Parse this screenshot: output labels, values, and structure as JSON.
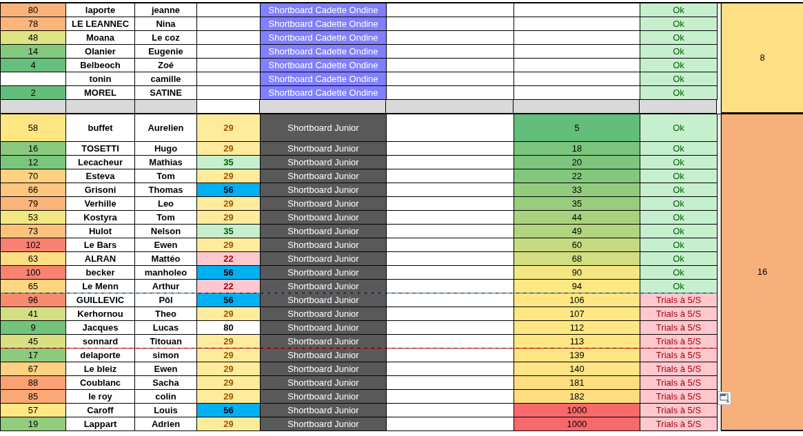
{
  "sections": [
    {
      "group": {
        "text": "8",
        "color": "#ffdf84"
      },
      "spacer_after": true,
      "rows": [
        {
          "rank": {
            "text": "80",
            "color": "#fbb27a"
          },
          "last": "laporte",
          "first": "jeanne",
          "category": {
            "text": "Shortboard Cadette Ondine",
            "kind": "cadette"
          },
          "status": {
            "text": "Ok",
            "kind": "ok"
          }
        },
        {
          "rank": {
            "text": "78",
            "color": "#fbb57b"
          },
          "last": "LE LEANNEC",
          "first": "Nina",
          "category": {
            "text": "Shortboard Cadette Ondine",
            "kind": "cadette"
          },
          "status": {
            "text": "Ok",
            "kind": "ok"
          }
        },
        {
          "rank": {
            "text": "48",
            "color": "#e1e383"
          },
          "last": "Moana",
          "first": "Le coz",
          "category": {
            "text": "Shortboard Cadette Ondine",
            "kind": "cadette"
          },
          "status": {
            "text": "Ok",
            "kind": "ok"
          }
        },
        {
          "rank": {
            "text": "14",
            "color": "#85c97d"
          },
          "last": "Olanier",
          "first": "Eugenie",
          "category": {
            "text": "Shortboard Cadette Ondine",
            "kind": "cadette"
          },
          "status": {
            "text": "Ok",
            "kind": "ok"
          }
        },
        {
          "rank": {
            "text": "4",
            "color": "#66bf7c"
          },
          "last": "Belbeoch",
          "first": "Zoé",
          "category": {
            "text": "Shortboard Cadette Ondine",
            "kind": "cadette"
          },
          "status": {
            "text": "Ok",
            "kind": "ok"
          }
        },
        {
          "last": "tonin",
          "first": "camille",
          "category": {
            "text": "Shortboard Cadette Ondine",
            "kind": "cadette"
          },
          "status": {
            "text": "Ok",
            "kind": "ok"
          }
        },
        {
          "rank": {
            "text": "2",
            "color": "#63be7b"
          },
          "last": "MOREL",
          "first": "SATINE",
          "category": {
            "text": "Shortboard Cadette Ondine",
            "kind": "cadette"
          },
          "status": {
            "text": "Ok",
            "kind": "ok"
          }
        }
      ]
    },
    {
      "group": {
        "text": "16",
        "color": "#f8b07a"
      },
      "spacer_after": false,
      "rows": [
        {
          "tall": true,
          "rank": {
            "text": "58",
            "color": "#fee783"
          },
          "last": "buffet",
          "first": "Aurelien",
          "age": {
            "text": "29",
            "kind": "yellow"
          },
          "category": {
            "text": "Shortboard Junior",
            "kind": "junior"
          },
          "points": {
            "text": "5",
            "color": "#63be7b"
          },
          "status": {
            "text": "Ok",
            "kind": "ok"
          }
        },
        {
          "rank": {
            "text": "16",
            "color": "#8aca7e"
          },
          "last": "TOSETTI",
          "first": "Hugo",
          "age": {
            "text": "29",
            "kind": "yellow"
          },
          "category": {
            "text": "Shortboard Junior",
            "kind": "junior"
          },
          "points": {
            "text": "18",
            "color": "#7bc47d"
          },
          "status": {
            "text": "Ok",
            "kind": "ok"
          }
        },
        {
          "rank": {
            "text": "12",
            "color": "#7bc67d"
          },
          "last": "Lecacheur",
          "first": "Mathias",
          "age": {
            "text": "35",
            "kind": "green"
          },
          "category": {
            "text": "Shortboard Junior",
            "kind": "junior"
          },
          "points": {
            "text": "20",
            "color": "#7ec57d"
          },
          "status": {
            "text": "Ok",
            "kind": "ok"
          }
        },
        {
          "rank": {
            "text": "70",
            "color": "#fed280"
          },
          "last": "Esteva",
          "first": "Tom",
          "age": {
            "text": "29",
            "kind": "yellow"
          },
          "category": {
            "text": "Shortboard Junior",
            "kind": "junior"
          },
          "points": {
            "text": "22",
            "color": "#83c77d"
          },
          "status": {
            "text": "Ok",
            "kind": "ok"
          }
        },
        {
          "rank": {
            "text": "66",
            "color": "#fdc57d"
          },
          "last": "Grisoni",
          "first": "Thomas",
          "age": {
            "text": "56",
            "kind": "blue"
          },
          "category": {
            "text": "Shortboard Junior",
            "kind": "junior"
          },
          "points": {
            "text": "33",
            "color": "#94cc7e"
          },
          "status": {
            "text": "Ok",
            "kind": "ok"
          }
        },
        {
          "rank": {
            "text": "79",
            "color": "#fbb47a"
          },
          "last": "Verhille",
          "first": "Leo",
          "age": {
            "text": "29",
            "kind": "yellow"
          },
          "category": {
            "text": "Shortboard Junior",
            "kind": "junior"
          },
          "points": {
            "text": "35",
            "color": "#98cd7e"
          },
          "status": {
            "text": "Ok",
            "kind": "ok"
          }
        },
        {
          "rank": {
            "text": "53",
            "color": "#f3e783"
          },
          "last": "Kostyra",
          "first": "Tom",
          "age": {
            "text": "29",
            "kind": "yellow"
          },
          "category": {
            "text": "Shortboard Junior",
            "kind": "junior"
          },
          "points": {
            "text": "44",
            "color": "#a9d27f"
          },
          "status": {
            "text": "Ok",
            "kind": "ok"
          }
        },
        {
          "rank": {
            "text": "73",
            "color": "#fdc17c"
          },
          "last": "Hulot",
          "first": "Nelson",
          "age": {
            "text": "35",
            "kind": "green"
          },
          "category": {
            "text": "Shortboard Junior",
            "kind": "junior"
          },
          "points": {
            "text": "49",
            "color": "#b1d47f"
          },
          "status": {
            "text": "Ok",
            "kind": "ok"
          }
        },
        {
          "rank": {
            "text": "102",
            "color": "#f8816f"
          },
          "last": "Le Bars",
          "first": "Ewen",
          "age": {
            "text": "29",
            "kind": "yellow"
          },
          "category": {
            "text": "Shortboard Junior",
            "kind": "junior"
          },
          "points": {
            "text": "60",
            "color": "#c4da80"
          },
          "status": {
            "text": "Ok",
            "kind": "ok"
          }
        },
        {
          "rank": {
            "text": "63",
            "color": "#fedd82"
          },
          "last": "ALRAN",
          "first": "Mattéo",
          "age": {
            "text": "22",
            "kind": "pink"
          },
          "category": {
            "text": "Shortboard Junior",
            "kind": "junior"
          },
          "points": {
            "text": "68",
            "color": "#d2de81"
          },
          "status": {
            "text": "Ok",
            "kind": "ok"
          }
        },
        {
          "rank": {
            "text": "100",
            "color": "#f8836f"
          },
          "last": "becker",
          "first": "manholeo",
          "age": {
            "text": "56",
            "kind": "blue"
          },
          "category": {
            "text": "Shortboard Junior",
            "kind": "junior"
          },
          "points": {
            "text": "90",
            "color": "#f4e783"
          },
          "status": {
            "text": "Ok",
            "kind": "ok"
          }
        },
        {
          "rank": {
            "text": "65",
            "color": "#fed680"
          },
          "last": "Le Menn",
          "first": "Arthur",
          "age": {
            "text": "22",
            "kind": "pink"
          },
          "category": {
            "text": "Shortboard Junior",
            "kind": "junior"
          },
          "points": {
            "text": "94",
            "color": "#fde883"
          },
          "status": {
            "text": "Ok",
            "kind": "ok"
          },
          "cutoff": {
            "color": "#2e75b6"
          }
        },
        {
          "rank": {
            "text": "96",
            "color": "#f98b71"
          },
          "last": "GUILLEVIC",
          "first": "Pôl",
          "age": {
            "text": "56",
            "kind": "blue"
          },
          "category": {
            "text": "Shortboard Junior",
            "kind": "junior"
          },
          "points": {
            "text": "106",
            "color": "#fee783"
          },
          "status": {
            "text": "Trials à 5/S",
            "kind": "trial"
          }
        },
        {
          "rank": {
            "text": "41",
            "color": "#d3df82"
          },
          "last": "Kerhornou",
          "first": "Theo",
          "age": {
            "text": "29",
            "kind": "yellow"
          },
          "category": {
            "text": "Shortboard Junior",
            "kind": "junior"
          },
          "points": {
            "text": "107",
            "color": "#fee783"
          },
          "status": {
            "text": "Trials à 5/S",
            "kind": "trial"
          }
        },
        {
          "rank": {
            "text": "9",
            "color": "#73c37c"
          },
          "last": "Jacques",
          "first": "Lucas",
          "age": {
            "text": "80",
            "kind": "plain"
          },
          "category": {
            "text": "Shortboard Junior",
            "kind": "junior"
          },
          "points": {
            "text": "112",
            "color": "#fee783"
          },
          "status": {
            "text": "Trials à 5/S",
            "kind": "trial"
          }
        },
        {
          "rank": {
            "text": "45",
            "color": "#d8e082"
          },
          "last": "sonnard",
          "first": "Titouan",
          "age": {
            "text": "29",
            "kind": "yellow"
          },
          "category": {
            "text": "Shortboard Junior",
            "kind": "junior"
          },
          "points": {
            "text": "113",
            "color": "#fee783"
          },
          "status": {
            "text": "Trials à 5/S",
            "kind": "trial"
          },
          "cutoff": {
            "color": "#ff0000"
          }
        },
        {
          "rank": {
            "text": "17",
            "color": "#8ccb7e"
          },
          "last": "delaporte",
          "first": "simon",
          "age": {
            "text": "29",
            "kind": "yellow"
          },
          "category": {
            "text": "Shortboard Junior",
            "kind": "junior"
          },
          "points": {
            "text": "139",
            "color": "#fee482"
          },
          "status": {
            "text": "Trials à 5/S",
            "kind": "trial"
          }
        },
        {
          "rank": {
            "text": "67",
            "color": "#fed07f"
          },
          "last": "Le bleiz",
          "first": "Ewen",
          "age": {
            "text": "29",
            "kind": "yellow"
          },
          "category": {
            "text": "Shortboard Junior",
            "kind": "junior"
          },
          "points": {
            "text": "140",
            "color": "#fee482"
          },
          "status": {
            "text": "Trials à 5/S",
            "kind": "trial"
          }
        },
        {
          "rank": {
            "text": "88",
            "color": "#faa275"
          },
          "last": "Coublanc",
          "first": "Sacha",
          "age": {
            "text": "29",
            "kind": "yellow"
          },
          "category": {
            "text": "Shortboard Junior",
            "kind": "junior"
          },
          "points": {
            "text": "181",
            "color": "#fedd81"
          },
          "status": {
            "text": "Trials à 5/S",
            "kind": "trial"
          }
        },
        {
          "rank": {
            "text": "85",
            "color": "#faa876"
          },
          "last": "le roy",
          "first": "colin",
          "age": {
            "text": "29",
            "kind": "yellow"
          },
          "category": {
            "text": "Shortboard Junior",
            "kind": "junior"
          },
          "points": {
            "text": "182",
            "color": "#fedd81"
          },
          "status": {
            "text": "Trials à 5/S",
            "kind": "trial"
          }
        },
        {
          "rank": {
            "text": "57",
            "color": "#ffe783"
          },
          "last": "Caroff",
          "first": "Louis",
          "age": {
            "text": "56",
            "kind": "blue"
          },
          "category": {
            "text": "Shortboard Junior",
            "kind": "junior"
          },
          "points": {
            "text": "1000",
            "color": "#f8696b"
          },
          "status": {
            "text": "Trials à 5/S",
            "kind": "trial"
          }
        },
        {
          "rank": {
            "text": "19",
            "color": "#92cd7e"
          },
          "last": "Lappart",
          "first": "Adrien",
          "age": {
            "text": "29",
            "kind": "yellow"
          },
          "category": {
            "text": "Shortboard Junior",
            "kind": "junior"
          },
          "points": {
            "text": "1000",
            "color": "#f8696b"
          },
          "status": {
            "text": "Trials à 5/S",
            "kind": "trial"
          }
        }
      ]
    }
  ]
}
